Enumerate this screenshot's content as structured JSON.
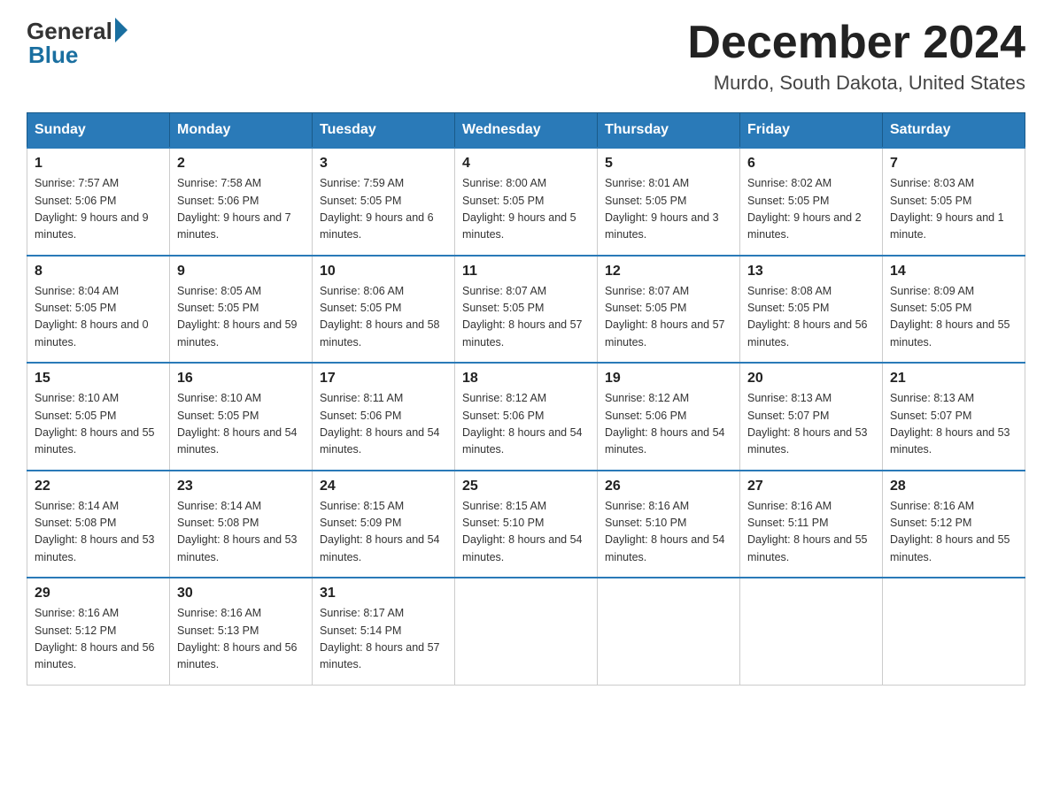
{
  "header": {
    "logo_general": "General",
    "logo_blue": "Blue",
    "month_title": "December 2024",
    "location": "Murdo, South Dakota, United States"
  },
  "days_of_week": [
    "Sunday",
    "Monday",
    "Tuesday",
    "Wednesday",
    "Thursday",
    "Friday",
    "Saturday"
  ],
  "weeks": [
    [
      {
        "day": "1",
        "sunrise": "7:57 AM",
        "sunset": "5:06 PM",
        "daylight": "9 hours and 9 minutes."
      },
      {
        "day": "2",
        "sunrise": "7:58 AM",
        "sunset": "5:06 PM",
        "daylight": "9 hours and 7 minutes."
      },
      {
        "day": "3",
        "sunrise": "7:59 AM",
        "sunset": "5:05 PM",
        "daylight": "9 hours and 6 minutes."
      },
      {
        "day": "4",
        "sunrise": "8:00 AM",
        "sunset": "5:05 PM",
        "daylight": "9 hours and 5 minutes."
      },
      {
        "day": "5",
        "sunrise": "8:01 AM",
        "sunset": "5:05 PM",
        "daylight": "9 hours and 3 minutes."
      },
      {
        "day": "6",
        "sunrise": "8:02 AM",
        "sunset": "5:05 PM",
        "daylight": "9 hours and 2 minutes."
      },
      {
        "day": "7",
        "sunrise": "8:03 AM",
        "sunset": "5:05 PM",
        "daylight": "9 hours and 1 minute."
      }
    ],
    [
      {
        "day": "8",
        "sunrise": "8:04 AM",
        "sunset": "5:05 PM",
        "daylight": "8 hours and 0 minutes."
      },
      {
        "day": "9",
        "sunrise": "8:05 AM",
        "sunset": "5:05 PM",
        "daylight": "8 hours and 59 minutes."
      },
      {
        "day": "10",
        "sunrise": "8:06 AM",
        "sunset": "5:05 PM",
        "daylight": "8 hours and 58 minutes."
      },
      {
        "day": "11",
        "sunrise": "8:07 AM",
        "sunset": "5:05 PM",
        "daylight": "8 hours and 57 minutes."
      },
      {
        "day": "12",
        "sunrise": "8:07 AM",
        "sunset": "5:05 PM",
        "daylight": "8 hours and 57 minutes."
      },
      {
        "day": "13",
        "sunrise": "8:08 AM",
        "sunset": "5:05 PM",
        "daylight": "8 hours and 56 minutes."
      },
      {
        "day": "14",
        "sunrise": "8:09 AM",
        "sunset": "5:05 PM",
        "daylight": "8 hours and 55 minutes."
      }
    ],
    [
      {
        "day": "15",
        "sunrise": "8:10 AM",
        "sunset": "5:05 PM",
        "daylight": "8 hours and 55 minutes."
      },
      {
        "day": "16",
        "sunrise": "8:10 AM",
        "sunset": "5:05 PM",
        "daylight": "8 hours and 54 minutes."
      },
      {
        "day": "17",
        "sunrise": "8:11 AM",
        "sunset": "5:06 PM",
        "daylight": "8 hours and 54 minutes."
      },
      {
        "day": "18",
        "sunrise": "8:12 AM",
        "sunset": "5:06 PM",
        "daylight": "8 hours and 54 minutes."
      },
      {
        "day": "19",
        "sunrise": "8:12 AM",
        "sunset": "5:06 PM",
        "daylight": "8 hours and 54 minutes."
      },
      {
        "day": "20",
        "sunrise": "8:13 AM",
        "sunset": "5:07 PM",
        "daylight": "8 hours and 53 minutes."
      },
      {
        "day": "21",
        "sunrise": "8:13 AM",
        "sunset": "5:07 PM",
        "daylight": "8 hours and 53 minutes."
      }
    ],
    [
      {
        "day": "22",
        "sunrise": "8:14 AM",
        "sunset": "5:08 PM",
        "daylight": "8 hours and 53 minutes."
      },
      {
        "day": "23",
        "sunrise": "8:14 AM",
        "sunset": "5:08 PM",
        "daylight": "8 hours and 53 minutes."
      },
      {
        "day": "24",
        "sunrise": "8:15 AM",
        "sunset": "5:09 PM",
        "daylight": "8 hours and 54 minutes."
      },
      {
        "day": "25",
        "sunrise": "8:15 AM",
        "sunset": "5:10 PM",
        "daylight": "8 hours and 54 minutes."
      },
      {
        "day": "26",
        "sunrise": "8:16 AM",
        "sunset": "5:10 PM",
        "daylight": "8 hours and 54 minutes."
      },
      {
        "day": "27",
        "sunrise": "8:16 AM",
        "sunset": "5:11 PM",
        "daylight": "8 hours and 55 minutes."
      },
      {
        "day": "28",
        "sunrise": "8:16 AM",
        "sunset": "5:12 PM",
        "daylight": "8 hours and 55 minutes."
      }
    ],
    [
      {
        "day": "29",
        "sunrise": "8:16 AM",
        "sunset": "5:12 PM",
        "daylight": "8 hours and 56 minutes."
      },
      {
        "day": "30",
        "sunrise": "8:16 AM",
        "sunset": "5:13 PM",
        "daylight": "8 hours and 56 minutes."
      },
      {
        "day": "31",
        "sunrise": "8:17 AM",
        "sunset": "5:14 PM",
        "daylight": "8 hours and 57 minutes."
      },
      null,
      null,
      null,
      null
    ]
  ],
  "labels": {
    "sunrise": "Sunrise:",
    "sunset": "Sunset:",
    "daylight": "Daylight:"
  }
}
